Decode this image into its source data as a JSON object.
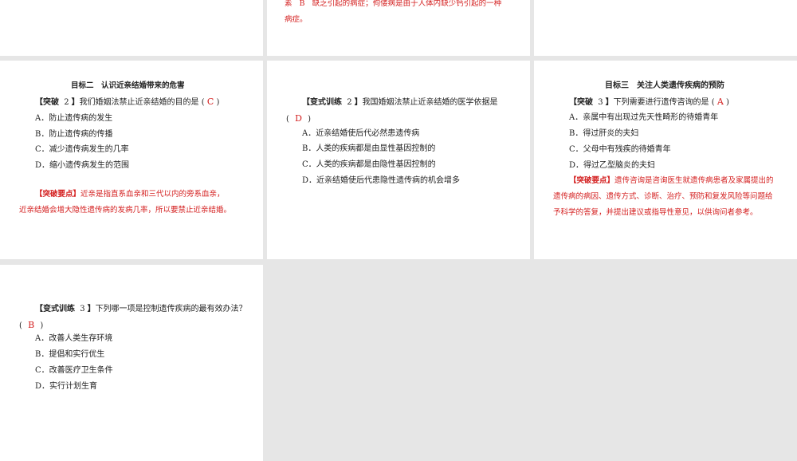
{
  "s2": {
    "line1_prefix": "素",
    "line1_letter": "B",
    "line1_rest": "缺乏引起的病症；佝偻病是由于人体内缺少钙引起的一种",
    "line2": "病症。"
  },
  "s4": {
    "heading": "目标二　认识近亲结婚带来的危害",
    "q_open": "【突破",
    "q_num": "2",
    "q_close": "】",
    "q_text": "我们婚姻法禁止近亲结婚的目的是 (",
    "q_answer": "C",
    "q_end": ")",
    "options": [
      "A．防止遗传病的发生",
      "B．防止遗传病的传播",
      "C．减少遗传病发生的几率",
      "D．缩小遗传病发生的范围"
    ],
    "key_label": "【突破要点】",
    "key_line1": "近亲是指直系血亲和三代以内的旁系血亲，",
    "key_line2": "近亲结婚会增大隐性遗传病的发病几率，所以要禁止近亲结婚。"
  },
  "s5": {
    "q_open": "【变式训练",
    "q_num": "2",
    "q_close": "】",
    "q_text": "我国婚姻法禁止近亲结婚的医学依据是",
    "paren_open": "(",
    "q_answer": "D",
    "paren_close": ")",
    "options": [
      "A．近亲结婚使后代必然患遗传病",
      "B．人类的疾病都是由显性基因控制的",
      "C．人类的疾病都是由隐性基因控制的",
      "D．近亲结婚使后代患隐性遗传病的机会增多"
    ]
  },
  "s6": {
    "heading": "目标三　关注人类遗传疾病的预防",
    "q_open": "【突破",
    "q_num": "3",
    "q_close": "】",
    "q_text": "下列需要进行遗传咨询的是 (",
    "q_answer": "A",
    "q_end": ")",
    "options": [
      "A．亲属中有出现过先天性畸形的待婚青年",
      "B．得过肝炎的夫妇",
      "C．父母中有残疾的待婚青年",
      "D．得过乙型脑炎的夫妇"
    ],
    "key_label": "【突破要点】",
    "key_text": "遗传咨询是咨询医生就遗传病患者及家属提出的遗传病的病因、遗传方式、诊断、治疗、预防和复发风险等问题给予科学的答复，并提出建议或指导性意见，以供询问者参考。"
  },
  "s7": {
    "q_open": "【变式训练",
    "q_num": "3",
    "q_close": "】",
    "q_text": "下列哪一项是控制遗传疾病的最有效办法？",
    "paren_open": "(",
    "q_answer": "B",
    "paren_close": ")",
    "options": [
      "A．改善人类生存环境",
      "B．提倡和实行优生",
      "C．改善医疗卫生条件",
      "D．实行计划生育"
    ]
  }
}
